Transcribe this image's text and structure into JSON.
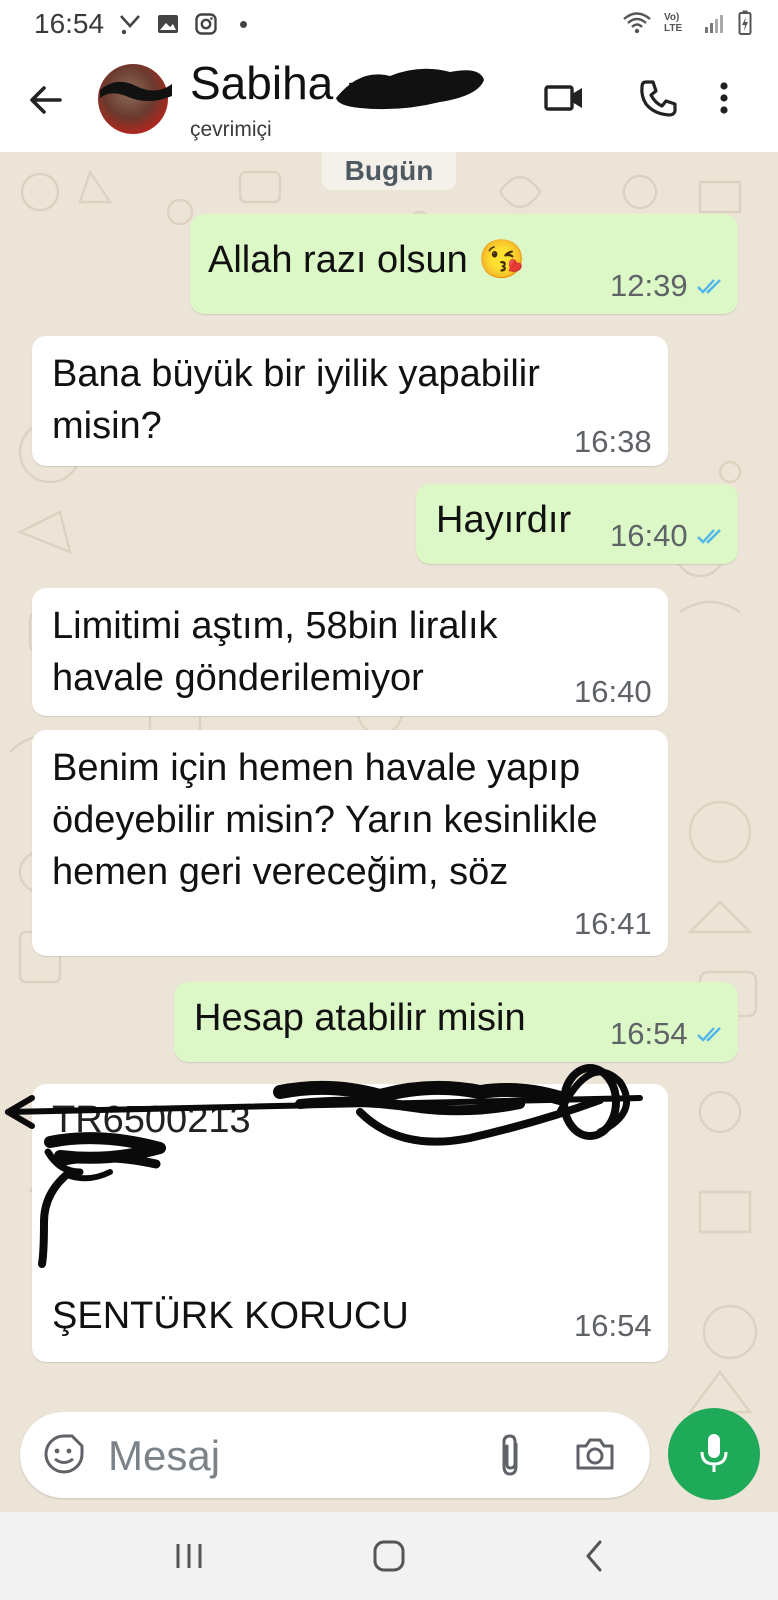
{
  "status_bar": {
    "time": "16:54",
    "lte_label": "Vo) LTE"
  },
  "header": {
    "contact_name": "Sabiha",
    "contact_status": "çevrimiçi"
  },
  "chat": {
    "date_label": "Bugün",
    "messages": [
      {
        "direction": "out",
        "text": "Allah razı olsun 😘",
        "time": "12:39",
        "read": true
      },
      {
        "direction": "in",
        "text": "Bana büyük bir iyilik yapabilir misin?",
        "time": "16:38"
      },
      {
        "direction": "out",
        "text": "Hayırdır",
        "time": "16:40",
        "read": true
      },
      {
        "direction": "in",
        "text": "Limitimi aştım, 58bin liralık havale gönderilemiyor",
        "time": "16:40"
      },
      {
        "direction": "in",
        "text": "Benim için hemen havale yapıp ödeyebilir misin? Yarın kesinlikle hemen geri vereceğim, söz",
        "time": "16:41"
      },
      {
        "direction": "out",
        "text": "Hesap atabilir misin",
        "time": "16:54",
        "read": true
      },
      {
        "direction": "in",
        "text_line1": "TR6500213",
        "text_name": "ŞENTÜRK KORUCU",
        "time": "16:54"
      }
    ]
  },
  "input": {
    "placeholder": "Mesaj"
  },
  "colors": {
    "outgoing_bubble": "#dcf8c6",
    "incoming_bubble": "#ffffff",
    "accent_green": "#1faa59",
    "tick_blue": "#4fb6ec"
  },
  "icons": [
    "back-arrow-icon",
    "video-call-icon",
    "voice-call-icon",
    "more-options-icon",
    "emoji-icon",
    "attach-icon",
    "camera-icon",
    "mic-icon",
    "recents-icon",
    "home-icon",
    "nav-back-icon"
  ]
}
